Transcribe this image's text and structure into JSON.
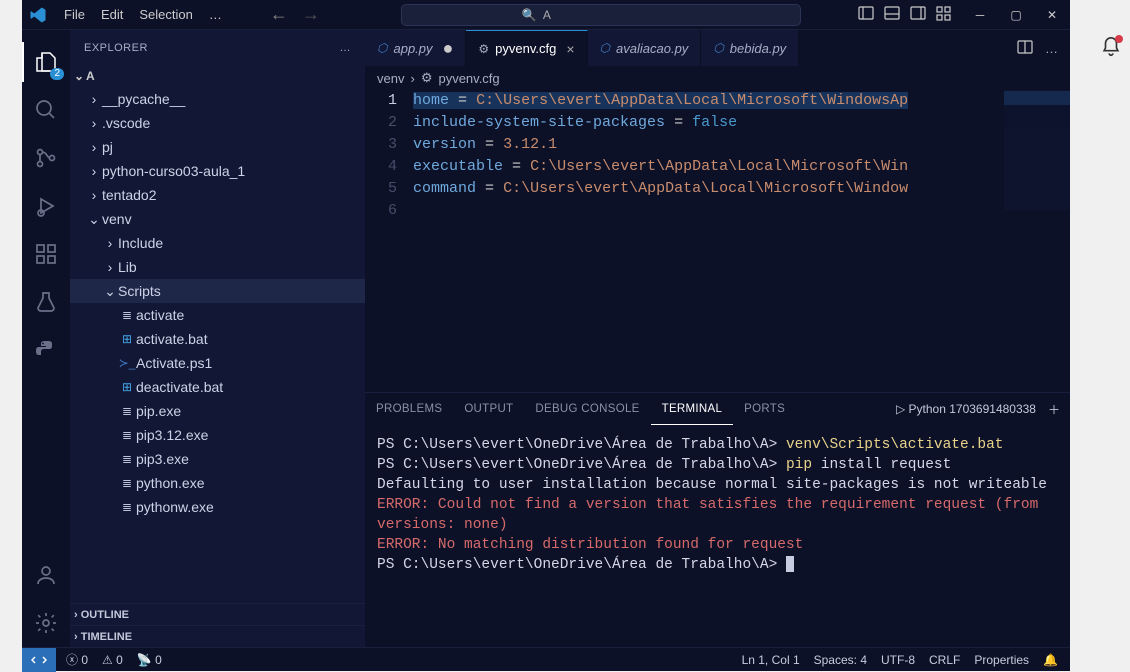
{
  "menubar": {
    "file": "File",
    "edit": "Edit",
    "selection": "Selection",
    "more": "…"
  },
  "search": {
    "label": "A"
  },
  "explorer": {
    "title": "EXPLORER",
    "root": "A",
    "folders": {
      "pycache": "__pycache__",
      "vscode": ".vscode",
      "pj": "pj",
      "curso": "python-curso03-aula_1",
      "tentado": "tentado2",
      "venv": "venv",
      "include": "Include",
      "lib": "Lib",
      "scripts": "Scripts"
    },
    "files": {
      "activate": "activate",
      "activate_bat": "activate.bat",
      "activate_ps1": "Activate.ps1",
      "deactivate_bat": "deactivate.bat",
      "pip": "pip.exe",
      "pip312": "pip3.12.exe",
      "pip3": "pip3.exe",
      "python": "python.exe",
      "pythonw": "pythonw.exe"
    },
    "outline": "OUTLINE",
    "timeline": "TIMELINE"
  },
  "activity_badge": "2",
  "tabs": {
    "app": "app.py",
    "pyvenv": "pyvenv.cfg",
    "avaliacao": "avaliacao.py",
    "bebida": "bebida.py"
  },
  "breadcrumb": {
    "root": "venv",
    "file": "pyvenv.cfg"
  },
  "code": {
    "l1_key": "home",
    "l1_val": "C:\\Users\\evert\\AppData\\Local\\Microsoft\\WindowsAp",
    "l2_key": "include-system-site-packages",
    "l2_val": "false",
    "l3_key": "version",
    "l3_val": "3.12.1",
    "l4_key": "executable",
    "l4_val": "C:\\Users\\evert\\AppData\\Local\\Microsoft\\Win",
    "l5_key": "command",
    "l5_val": "C:\\Users\\evert\\AppData\\Local\\Microsoft\\Window"
  },
  "panel": {
    "problems": "PROBLEMS",
    "output": "OUTPUT",
    "debug": "DEBUG CONSOLE",
    "terminal": "TERMINAL",
    "ports": "PORTS",
    "task": "Python 1703691480338"
  },
  "terminal": {
    "ps1a": "PS C:\\Users\\evert\\OneDrive\\Área de Trabalho\\A> ",
    "cmd1": "venv\\Scripts\\activate.bat",
    "ps2": "PS C:\\Users\\evert\\OneDrive\\Área de Trabalho\\A> ",
    "cmd2": "pip",
    "cmd2b": " install request",
    "out1": "Defaulting to user installation because normal site-packages is not writeable",
    "err1": "ERROR: Could not find a version that satisfies the requirement request (from versions: none)",
    "err2": "ERROR: No matching distribution found for request",
    "ps3": "PS C:\\Users\\evert\\OneDrive\\Área de Trabalho\\A> "
  },
  "status": {
    "errors": "0",
    "warnings": "0",
    "ports": "0",
    "lncol": "Ln 1, Col 1",
    "spaces": "Spaces: 4",
    "enc": "UTF-8",
    "eol": "CRLF",
    "lang": "Properties"
  }
}
